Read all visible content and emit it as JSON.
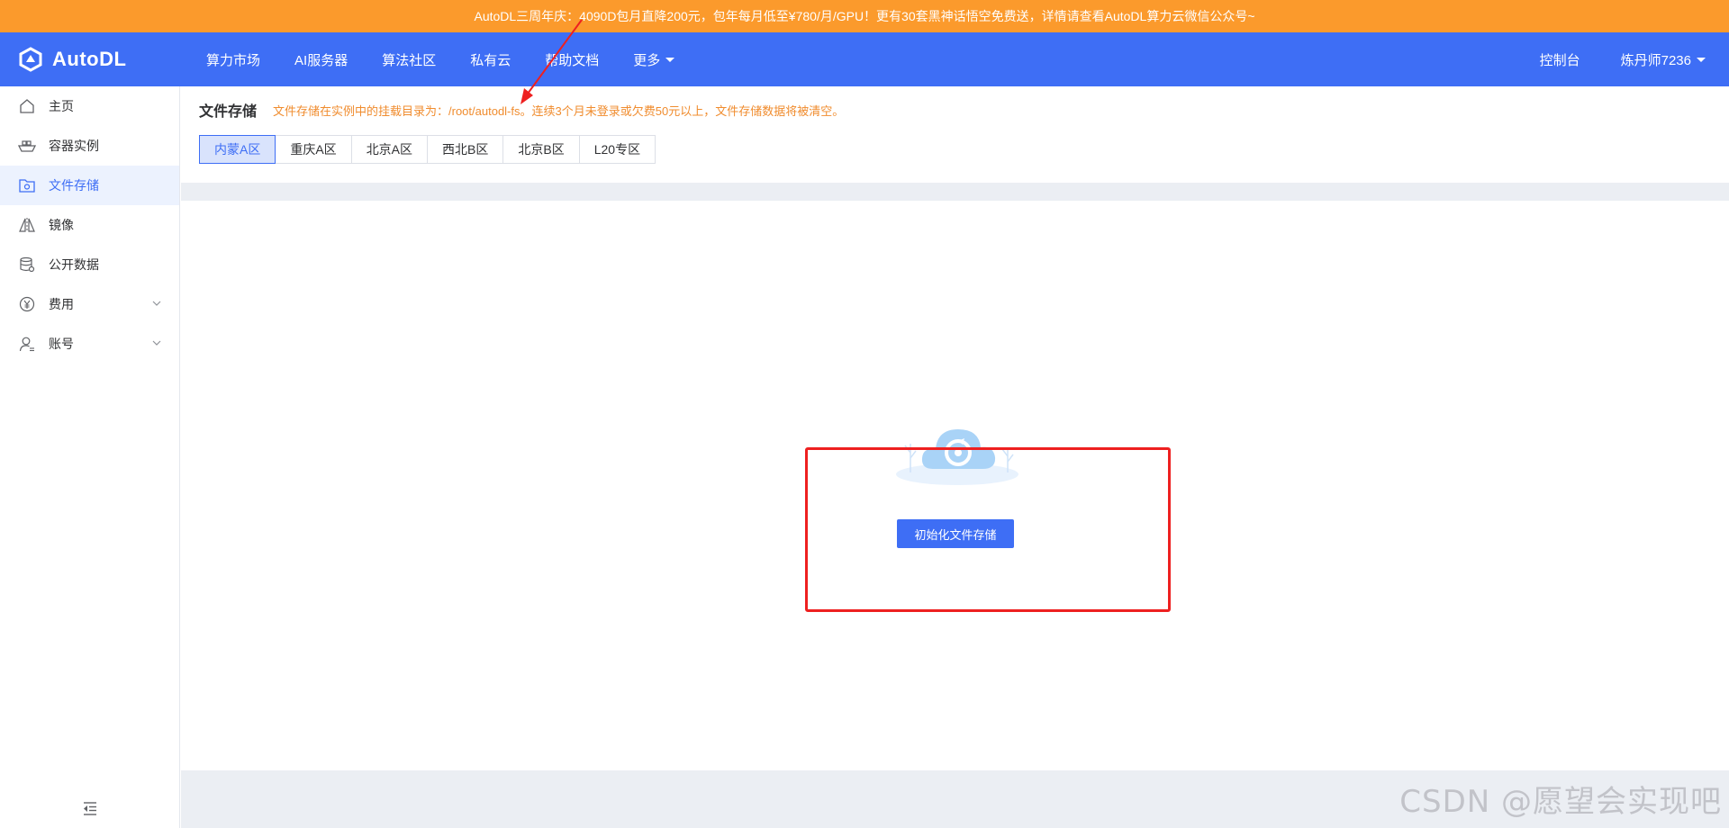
{
  "banner": {
    "text": "AutoDL三周年庆：4090D包月直降200元，包年每月低至¥780/月/GPU！更有30套黑神话悟空免费送，详情请查看AutoDL算力云微信公众号~"
  },
  "topnav": {
    "brand": "AutoDL",
    "items": [
      {
        "label": "算力市场"
      },
      {
        "label": "AI服务器"
      },
      {
        "label": "算法社区"
      },
      {
        "label": "私有云"
      },
      {
        "label": "帮助文档"
      },
      {
        "label": "更多"
      }
    ],
    "console": "控制台",
    "user": "炼丹师7236"
  },
  "sidebar": {
    "items": [
      {
        "label": "主页",
        "icon": "home-icon"
      },
      {
        "label": "容器实例",
        "icon": "container-icon"
      },
      {
        "label": "文件存储",
        "icon": "file-storage-icon",
        "active": true
      },
      {
        "label": "镜像",
        "icon": "mirror-icon"
      },
      {
        "label": "公开数据",
        "icon": "database-icon"
      },
      {
        "label": "费用",
        "icon": "yen-icon",
        "expandable": true
      },
      {
        "label": "账号",
        "icon": "user-icon",
        "expandable": true
      }
    ]
  },
  "main": {
    "title": "文件存储",
    "notice": "文件存储在实例中的挂载目录为：/root/autodl-fs。连续3个月未登录或欠费50元以上，文件存储数据将被清空。",
    "tabs": [
      {
        "label": "内蒙A区",
        "active": true
      },
      {
        "label": "重庆A区"
      },
      {
        "label": "北京A区"
      },
      {
        "label": "西北B区"
      },
      {
        "label": "北京B区"
      },
      {
        "label": "L20专区"
      }
    ],
    "init_button": "初始化文件存储"
  },
  "watermark": "CSDN @愿望会实现吧",
  "colors": {
    "banner": "#fb9a2c",
    "nav": "#3e6ef5",
    "accent": "#3e6ef5",
    "notice": "#f08c2e",
    "annotation": "#ee2020"
  }
}
